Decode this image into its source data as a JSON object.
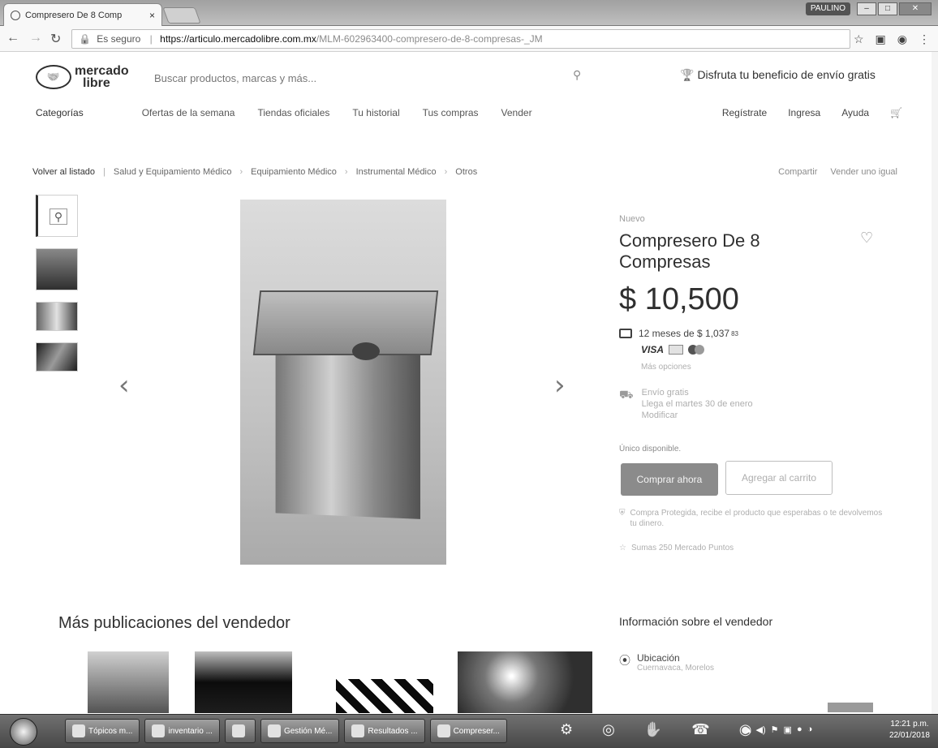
{
  "browser": {
    "tab_title": "Compresero De 8 Comp",
    "tab_close": "×",
    "profile": "PAULINO",
    "url_secure_label": "Es seguro",
    "url_host": "https://articulo.mercadolibre.com.mx",
    "url_path": "/MLM-602963400-compresero-de-8-compresas-_JM"
  },
  "site": {
    "logo_line1": "mercado",
    "logo_line2": "libre",
    "search_placeholder": "Buscar productos, marcas y más...",
    "benefit": "Disfruta tu beneficio de envío gratis"
  },
  "nav": {
    "categories": "Categorías",
    "items": [
      "Ofertas de la semana",
      "Tiendas oficiales",
      "Tu historial",
      "Tus compras",
      "Vender"
    ],
    "right": [
      "Regístrate",
      "Ingresa",
      "Ayuda"
    ]
  },
  "breadcrumb": {
    "back": "Volver al listado",
    "items": [
      "Salud y Equipamiento Médico",
      "Equipamiento Médico",
      "Instrumental Médico",
      "Otros"
    ],
    "share": "Compartir",
    "sell_same": "Vender uno igual"
  },
  "product": {
    "condition": "Nuevo",
    "title": "Compresero De 8 Compresas",
    "price": "$ 10,500",
    "installments": "12 meses de $ 1,037",
    "installments_sup": "83",
    "visa": "VISA",
    "more_options": "Más opciones",
    "shipping_title": "Envío gratis",
    "shipping_line2": "Llega el martes 30 de enero",
    "shipping_line3": "Modificar",
    "stock": "Único disponible.",
    "buy_button": "Comprar ahora",
    "cart_button": "Agregar al carrito",
    "guarantee": "Compra Protegida, recibe el producto que esperabas o te devolvemos tu dinero.",
    "points": "Sumas 250 Mercado Puntos"
  },
  "bottom": {
    "more_pubs": "Más publicaciones del vendedor",
    "seller_info": "Información sobre el vendedor",
    "location_label": "Ubicación",
    "location_value": "Cuernavaca, Morelos"
  },
  "taskbar": {
    "tasks": [
      "Tópicos m...",
      "inventario ...",
      "",
      "Gestión Mé...",
      "Resultados ...",
      "Compreser..."
    ],
    "time": "12:21 p.m.",
    "date": "22/01/2018"
  }
}
